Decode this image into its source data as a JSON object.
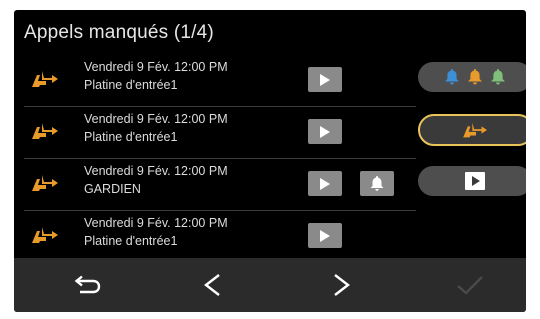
{
  "screen": {
    "title": "Appels manqués (1/4)"
  },
  "calls": [
    {
      "datetime": "Vendredi 9 Fév. 12:00 PM",
      "source": "Platine d'entrée1",
      "has_bell": false
    },
    {
      "datetime": "Vendredi 9 Fév. 12:00 PM",
      "source": "Platine d'entrée1",
      "has_bell": false
    },
    {
      "datetime": "Vendredi 9 Fév. 12:00 PM",
      "source": "GARDIEN",
      "has_bell": true
    },
    {
      "datetime": "Vendredi 9 Fév. 12:00 PM",
      "source": "Platine d'entrée1",
      "has_bell": false
    }
  ],
  "side_buttons": [
    {
      "icon": "bells-multicolor-icon",
      "colors": [
        "#3d8fd6",
        "#e89a2a",
        "#7fbf7a"
      ]
    },
    {
      "icon": "missed-call-icon",
      "selected": true,
      "color": "#e89a2a"
    },
    {
      "icon": "play-box-icon"
    }
  ],
  "bottom_nav": [
    {
      "icon": "back-icon",
      "enabled": true
    },
    {
      "icon": "previous-icon",
      "enabled": true
    },
    {
      "icon": "next-icon",
      "enabled": true
    },
    {
      "icon": "check-icon",
      "enabled": false
    }
  ],
  "colors": {
    "accent_orange": "#e89a2a",
    "selected_border": "#e9c45a",
    "button_gray": "#8a8a8a"
  }
}
